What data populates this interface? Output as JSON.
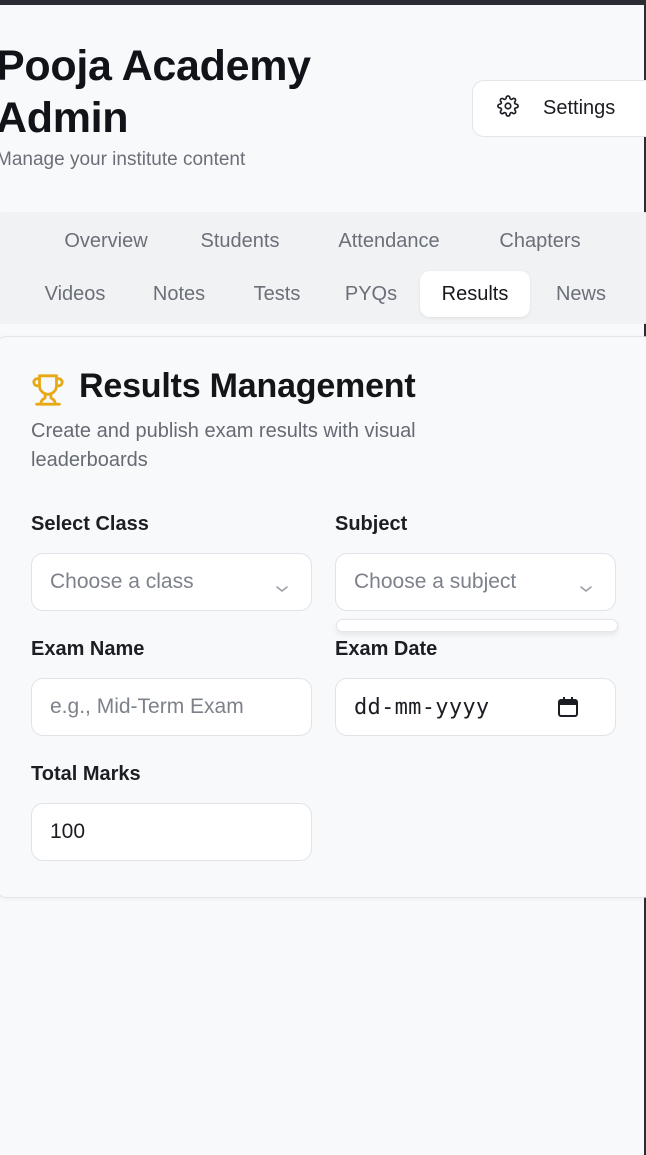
{
  "header": {
    "title": "Pooja Academy Admin",
    "subtitle": "Manage your institute content",
    "settings_label": "Settings"
  },
  "tabs": {
    "row1": [
      "Overview",
      "Students",
      "Attendance",
      "Chapters"
    ],
    "row2": [
      "Videos",
      "Notes",
      "Tests",
      "PYQs",
      "Results",
      "News"
    ],
    "active": "Results"
  },
  "results": {
    "title": "Results Management",
    "description": "Create and publish exam results with visual leaderboards",
    "select_class_label": "Select Class",
    "select_class_placeholder": "Choose a class",
    "subject_label": "Subject",
    "subject_placeholder": "Choose a subject",
    "exam_name_label": "Exam Name",
    "exam_name_placeholder": "e.g., Mid-Term Exam",
    "exam_date_label": "Exam Date",
    "exam_date_placeholder": "dd-mm-yyyy",
    "total_marks_label": "Total Marks",
    "total_marks_value": "100"
  },
  "colors": {
    "accent_trophy": "#e8a917",
    "background": "#f8f9fb",
    "text_muted": "#6b6f78"
  },
  "icons": {
    "settings": "gear-icon",
    "results": "trophy-icon",
    "select": "chevron-down-icon",
    "date": "calendar-icon"
  }
}
